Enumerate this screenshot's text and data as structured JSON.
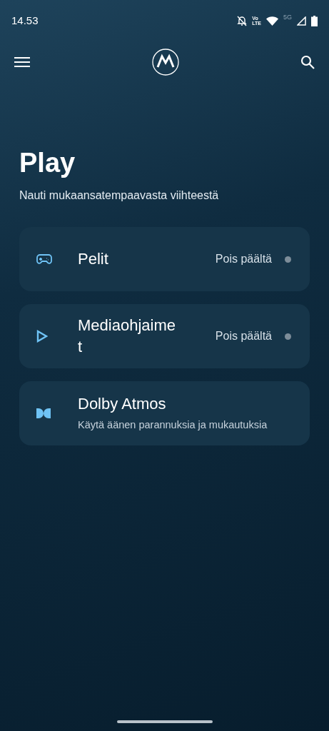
{
  "status_bar": {
    "time": "14.53",
    "volte_top": "Vo",
    "volte_bottom": "LTE",
    "network": "5G"
  },
  "header": {
    "title": "Play",
    "subtitle": "Nauti mukaansatempaavasta viihteestä"
  },
  "items": [
    {
      "kind": "toggle",
      "title": "Pelit",
      "status": "Pois päältä",
      "on": false
    },
    {
      "kind": "toggle",
      "title": "Mediaohjaimet",
      "status": "Pois päältä",
      "on": false
    },
    {
      "kind": "link",
      "title": "Dolby Atmos",
      "description": "Käytä äänen parannuksia ja mukautuksia"
    }
  ]
}
